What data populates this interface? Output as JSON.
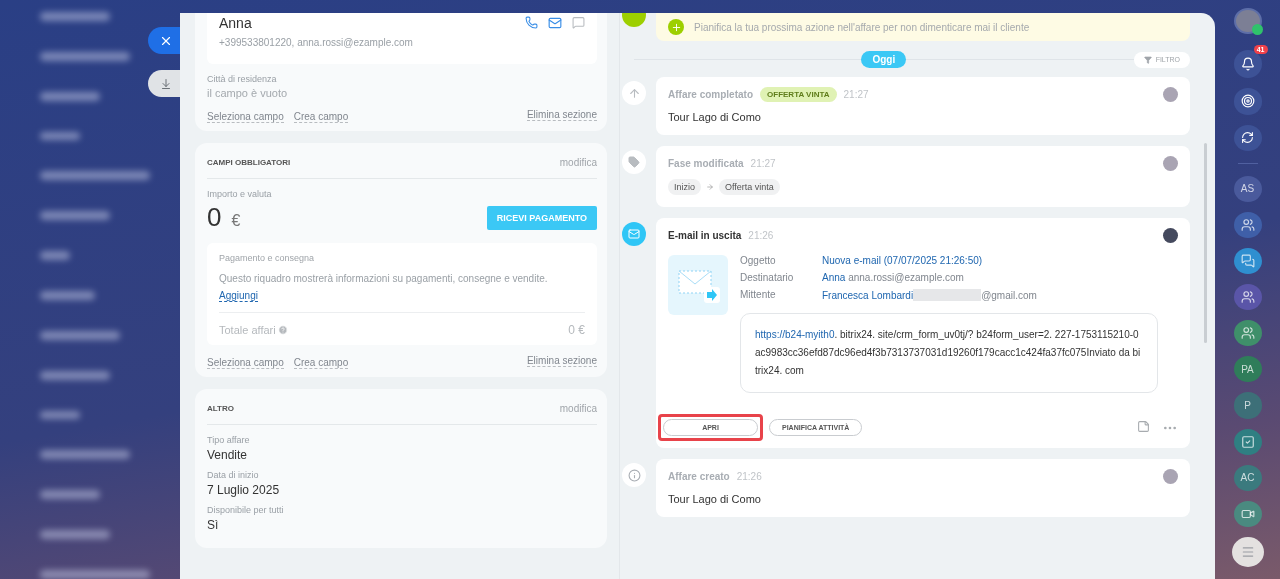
{
  "contact_section": {
    "name": "Anna",
    "details": "+399533801220, anna.rossi@ezample.com",
    "fields": [
      {
        "label": "Città di residenza",
        "value": "il campo è vuoto",
        "empty": true
      }
    ],
    "links": [
      "Seleziona campo",
      "Crea campo"
    ],
    "delete_link": "Elimina sezione"
  },
  "required_section": {
    "title": "CAMPI OBBLIGATORI",
    "edit": "modifica",
    "amount_label": "Importo e valuta",
    "amount": "0",
    "currency": "€",
    "pay_button": "RICEVI PAGAMENTO",
    "payment_box": {
      "title": "Pagamento e consegna",
      "text": "Questo riquadro mostrerà informazioni su pagamenti, consegne e vendite.",
      "add_link": "Aggiungi",
      "total_label": "Totale affari",
      "total": "0 €"
    },
    "links": [
      "Seleziona campo",
      "Crea campo"
    ],
    "delete_link": "Elimina sezione"
  },
  "other_section": {
    "title": "ALTRO",
    "edit": "modifica",
    "fields": [
      {
        "label": "Tipo affare",
        "value": "Vendite",
        "empty": false
      },
      {
        "label": "Data di inizio",
        "value": "7 Luglio 2025",
        "empty": false
      },
      {
        "label": "Disponibile per tutti",
        "value": "Sì",
        "empty": false
      }
    ]
  },
  "timeline": {
    "add_hint": "Pianifica la tua prossima azione nell'affare per non dimenticare mai il cliente",
    "day": "Oggi",
    "filter": "FILTRO",
    "events": [
      {
        "kind": "completed",
        "title": "Affare completato",
        "badge": "OFFERTA VINTA",
        "time": "21:27",
        "text": "Tour Lago di Como"
      },
      {
        "kind": "stage",
        "title": "Fase modificata",
        "time": "21:27",
        "stages": [
          "Inizio",
          "Offerta vinta"
        ]
      },
      {
        "kind": "email",
        "title": "E-mail in uscita",
        "time": "21:26",
        "fields": [
          {
            "label": "Oggetto",
            "value": "Nuova e-mail (07/07/2025 21:26:50)"
          },
          {
            "label": "Destinatario",
            "value": "Anna",
            "extra": "anna.rossi@ezample.com"
          },
          {
            "label": "Mittente",
            "value": "Francesca Lombardi",
            "extra": "@gmail.com",
            "redacted": true
          }
        ],
        "body_link": "https://b24-myith0",
        "body": ". bitrix24. site/crm_form_uv0tj/? b24form_user=2. 227-1753115210-0ac9983cc36efd87dc96ed4f3b7313737031d19260f179cacc1c424fa37fc075Inviato da bitrix24. com",
        "actions": [
          {
            "label": "APRI",
            "highlighted": true
          },
          {
            "label": "PIANIFICA ATTIVITÀ",
            "highlighted": false
          }
        ]
      },
      {
        "kind": "created",
        "title": "Affare creato",
        "time": "21:26",
        "text": "Tour Lago di Como"
      }
    ]
  },
  "rail": {
    "notifications": "41",
    "items": [
      {
        "kind": "initials",
        "text": "AS",
        "color": "#4a5a9c"
      },
      {
        "kind": "group",
        "color": "#3f5fa8"
      },
      {
        "kind": "chat",
        "color": "#2f8fd0"
      },
      {
        "kind": "group",
        "color": "#5a55a8"
      },
      {
        "kind": "group",
        "color": "#3f8f6a"
      },
      {
        "kind": "initials",
        "text": "PA",
        "color": "#2f7d5a"
      },
      {
        "kind": "initials",
        "text": "P",
        "color": "#3d6f78"
      },
      {
        "kind": "check",
        "color": "#2f7f82"
      },
      {
        "kind": "initials",
        "text": "AC",
        "color": "#3b7a7e"
      },
      {
        "kind": "video",
        "color": "#4a8a80"
      }
    ]
  }
}
